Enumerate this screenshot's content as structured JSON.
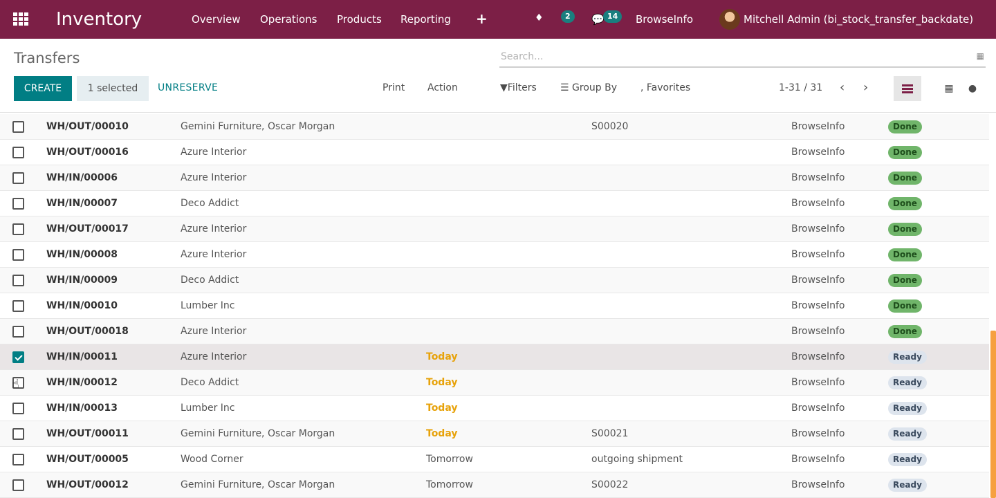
{
  "navbar": {
    "app_name": "Inventory",
    "menu": [
      "Overview",
      "Operations",
      "Products",
      "Reporting"
    ],
    "plus": "+",
    "activity_count": "2",
    "message_count": "14",
    "company": "BrowseInfo",
    "user": "Mitchell Admin (bi_stock_transfer_backdate)"
  },
  "control_panel": {
    "title": "Transfers",
    "search_placeholder": "Search...",
    "create_label": "CREATE",
    "selected_label": "1 selected",
    "unreserve_label": "UNRESERVE",
    "print_label": "Print",
    "action_label": "Action",
    "filters_label": "Filters",
    "groupby_label": "Group By",
    "favorites_label": "Favorites",
    "pager": "1-31 / 31"
  },
  "rows": [
    {
      "ref": "WH/OUT/00010",
      "partner": "Gemini Furniture, Oscar Morgan",
      "scheduled": "",
      "source": "S00020",
      "company": "BrowseInfo",
      "status": "Done",
      "checked": false
    },
    {
      "ref": "WH/OUT/00016",
      "partner": "Azure Interior",
      "scheduled": "",
      "source": "",
      "company": "BrowseInfo",
      "status": "Done",
      "checked": false
    },
    {
      "ref": "WH/IN/00006",
      "partner": "Azure Interior",
      "scheduled": "",
      "source": "",
      "company": "BrowseInfo",
      "status": "Done",
      "checked": false
    },
    {
      "ref": "WH/IN/00007",
      "partner": "Deco Addict",
      "scheduled": "",
      "source": "",
      "company": "BrowseInfo",
      "status": "Done",
      "checked": false
    },
    {
      "ref": "WH/OUT/00017",
      "partner": "Azure Interior",
      "scheduled": "",
      "source": "",
      "company": "BrowseInfo",
      "status": "Done",
      "checked": false
    },
    {
      "ref": "WH/IN/00008",
      "partner": "Azure Interior",
      "scheduled": "",
      "source": "",
      "company": "BrowseInfo",
      "status": "Done",
      "checked": false
    },
    {
      "ref": "WH/IN/00009",
      "partner": "Deco Addict",
      "scheduled": "",
      "source": "",
      "company": "BrowseInfo",
      "status": "Done",
      "checked": false
    },
    {
      "ref": "WH/IN/00010",
      "partner": "Lumber Inc",
      "scheduled": "",
      "source": "",
      "company": "BrowseInfo",
      "status": "Done",
      "checked": false
    },
    {
      "ref": "WH/OUT/00018",
      "partner": "Azure Interior",
      "scheduled": "",
      "source": "",
      "company": "BrowseInfo",
      "status": "Done",
      "checked": false
    },
    {
      "ref": "WH/IN/00011",
      "partner": "Azure Interior",
      "scheduled": "Today",
      "source": "",
      "company": "BrowseInfo",
      "status": "Ready",
      "checked": true
    },
    {
      "ref": "WH/IN/00012",
      "partner": "Deco Addict",
      "scheduled": "Today",
      "source": "",
      "company": "BrowseInfo",
      "status": "Ready",
      "checked": false
    },
    {
      "ref": "WH/IN/00013",
      "partner": "Lumber Inc",
      "scheduled": "Today",
      "source": "",
      "company": "BrowseInfo",
      "status": "Ready",
      "checked": false
    },
    {
      "ref": "WH/OUT/00011",
      "partner": "Gemini Furniture, Oscar Morgan",
      "scheduled": "Today",
      "source": "S00021",
      "company": "BrowseInfo",
      "status": "Ready",
      "checked": false
    },
    {
      "ref": "WH/OUT/00005",
      "partner": "Wood Corner",
      "scheduled": "Tomorrow",
      "source": "outgoing shipment",
      "company": "BrowseInfo",
      "status": "Ready",
      "checked": false
    },
    {
      "ref": "WH/OUT/00012",
      "partner": "Gemini Furniture, Oscar Morgan",
      "scheduled": "Tomorrow",
      "source": "S00022",
      "company": "BrowseInfo",
      "status": "Ready",
      "checked": false
    }
  ],
  "colors": {
    "navbar": "#7c1f46",
    "primary": "#017e84",
    "today": "#e7a20a",
    "done": "#70b56a",
    "ready": "#dde4ed"
  }
}
